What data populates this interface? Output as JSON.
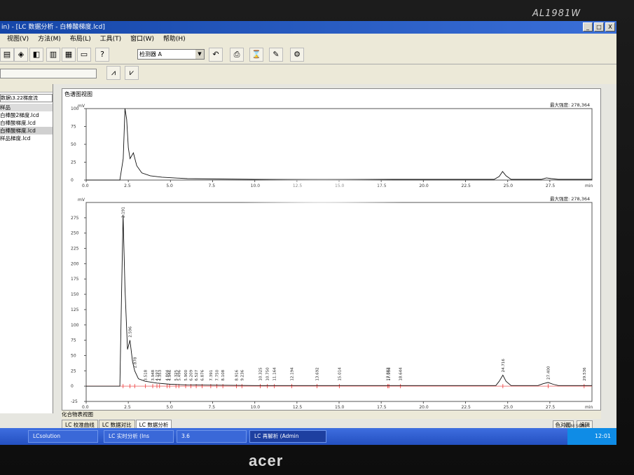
{
  "monitor": {
    "model": "AL1981W",
    "brand": "acer"
  },
  "window": {
    "title": "in) - [LC 数据分析 - 白棒酸梯度.lcd]",
    "buttons": [
      "_",
      "□",
      "X"
    ]
  },
  "menu": [
    "视图(V)",
    "方法(M)",
    "布局(L)",
    "工具(T)",
    "窗口(W)",
    "帮助(H)"
  ],
  "toolbar": {
    "detector_select": "检测器 A",
    "help_icon": "?"
  },
  "left_panel": {
    "combo": "数据\\3.22梯度流",
    "files": [
      {
        "name": "样品",
        "selected": false,
        "header": true
      },
      {
        "name": "白棒酸2梯度.lcd",
        "selected": false
      },
      {
        "name": "白棒酸梯度.lcd",
        "selected": false
      },
      {
        "name": "白棒酸梯度.lcd",
        "selected": true
      },
      {
        "name": "样品梯度.lcd",
        "selected": false
      }
    ]
  },
  "chromatogram": {
    "panel_title": "色谱图视图",
    "bottom_panel_title": "化合物表视图",
    "max_intensity_label": "最大强度: 278,364"
  },
  "chart_data": [
    {
      "type": "line",
      "name": "overview",
      "ylabel": "mV",
      "xlabel": "min",
      "xlim": [
        0,
        30
      ],
      "ylim": [
        0,
        100
      ],
      "xticks": [
        "0.0",
        "2.5",
        "5.0",
        "7.5",
        "10.0",
        "12.5",
        "15.0",
        "17.5",
        "20.0",
        "22.5",
        "25.0",
        "27.5"
      ],
      "yticks": [
        "0",
        "25",
        "50",
        "75",
        "100"
      ],
      "x": [
        0,
        2.0,
        2.2,
        2.3,
        2.4,
        2.5,
        2.6,
        2.8,
        3.0,
        3.3,
        3.8,
        4.5,
        6,
        10,
        15,
        20,
        24.2,
        24.5,
        24.7,
        24.9,
        25.2,
        26,
        27.0,
        27.3,
        27.6,
        28,
        30
      ],
      "y": [
        0,
        0,
        30,
        100,
        85,
        45,
        30,
        38,
        20,
        10,
        6,
        4,
        2,
        1,
        1,
        1,
        1,
        5,
        12,
        6,
        1,
        1,
        1,
        3,
        2,
        1,
        1
      ]
    },
    {
      "type": "line",
      "name": "detail",
      "ylabel": "mV",
      "xlabel": "min",
      "xlim": [
        0,
        30
      ],
      "ylim": [
        -25,
        300
      ],
      "xticks": [
        "0.0",
        "2.5",
        "5.0",
        "7.5",
        "10.0",
        "12.5",
        "15.0",
        "17.5",
        "20.0",
        "22.5",
        "25.0",
        "27.5"
      ],
      "yticks": [
        "-25",
        "0",
        "25",
        "50",
        "75",
        "100",
        "125",
        "150",
        "175",
        "200",
        "225",
        "250",
        "275"
      ],
      "x": [
        0,
        2.0,
        2.1,
        2.191,
        2.3,
        2.45,
        2.596,
        2.75,
        2.878,
        3.1,
        3.5,
        4.2,
        5,
        6,
        10,
        20,
        24.3,
        24.5,
        24.716,
        24.9,
        25.2,
        26.8,
        27.1,
        27.4,
        27.7,
        28,
        30
      ],
      "y": [
        0,
        0,
        150,
        280,
        160,
        60,
        75,
        40,
        25,
        12,
        8,
        5,
        3,
        2,
        1,
        1,
        1,
        8,
        18,
        8,
        1,
        1,
        4,
        6,
        3,
        1,
        1
      ],
      "peak_labels": [
        "2.191",
        "2.596",
        "2.878",
        "3.518",
        "3.948",
        "4.197",
        "4.353",
        "4.804",
        "4.946",
        "5.325",
        "5.496",
        "5.900",
        "6.209",
        "6.527",
        "6.876",
        "7.391",
        "7.750",
        "8.108",
        "8.916",
        "9.236",
        "10.325",
        "10.750",
        "11.164",
        "12.194",
        "13.692",
        "15.014",
        "17.883",
        "17.956",
        "18.644",
        "24.716",
        "27.400",
        "29.536"
      ],
      "peak_times": [
        2.191,
        2.596,
        2.878,
        3.518,
        3.948,
        4.197,
        4.353,
        4.804,
        4.946,
        5.325,
        5.496,
        5.9,
        6.209,
        6.527,
        6.876,
        7.391,
        7.75,
        8.108,
        8.916,
        9.236,
        10.325,
        10.75,
        11.164,
        12.194,
        13.692,
        15.014,
        17.883,
        17.956,
        18.644,
        24.716,
        27.4,
        29.536
      ],
      "peak_heights": [
        280,
        75,
        25,
        4,
        4,
        4,
        4,
        4,
        4,
        4,
        4,
        4,
        4,
        4,
        4,
        4,
        4,
        4,
        4,
        4,
        4,
        4,
        4,
        4,
        4,
        4,
        4,
        4,
        4,
        18,
        6,
        4
      ]
    }
  ],
  "tabs": [
    "LC 校准曲线",
    "LC 数据对比",
    "LC 数据分析"
  ],
  "right_buttons": [
    "色对图",
    "编辑"
  ],
  "status": {
    "num": "NUM",
    "scrl": "SCRL"
  },
  "taskbar": {
    "items": [
      "LCsolution",
      "LC 实时分析 (Ins",
      "3.6",
      "LC 再解析 (Admin"
    ],
    "clock": "12:01"
  }
}
